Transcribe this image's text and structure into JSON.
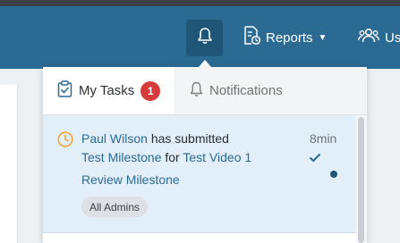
{
  "navbar": {
    "reports_label": "Reports",
    "users_label": "Us"
  },
  "dropdown": {
    "tabs": [
      {
        "label": "My Tasks",
        "badge": "1",
        "active": true
      },
      {
        "label": "Notifications",
        "active": false
      }
    ],
    "task": {
      "actor": "Paul Wilson",
      "action": "has submitted",
      "milestone": "Test Milestone",
      "connector": "for",
      "video": "Test Video 1",
      "review_link": "Review Milestone",
      "tag": "All Admins",
      "time": "8min"
    }
  },
  "colors": {
    "navbar": "#2b6a93",
    "accent_link": "#2b6a93",
    "badge": "#d63a3a",
    "row_highlight": "#e2eef8",
    "clock": "#f0a53a"
  },
  "icons": {
    "bell": "bell-icon",
    "reports": "report-document-icon",
    "users": "users-icon",
    "tasks": "clipboard-check-icon",
    "notifications": "bell-outline-icon",
    "clock": "clock-icon",
    "check": "checkmark-icon"
  }
}
